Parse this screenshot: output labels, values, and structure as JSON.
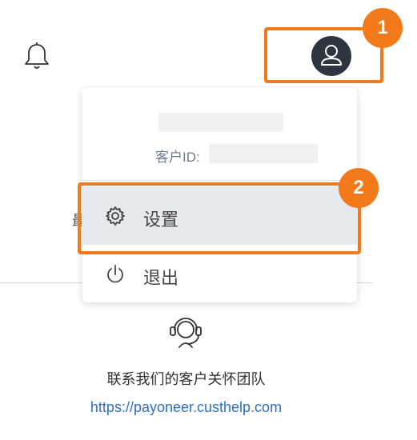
{
  "header": {
    "bell_icon": "bell-icon",
    "avatar_icon": "user-icon"
  },
  "badges": {
    "step1": "1",
    "step2": "2"
  },
  "menu": {
    "customer_id_label": "客户ID:",
    "items": [
      {
        "label": "设置",
        "icon": "gear-icon"
      },
      {
        "label": "退出",
        "icon": "power-icon"
      }
    ]
  },
  "support": {
    "text": "联系我们的客户关怀团队",
    "link": "https://payoneer.custhelp.com",
    "icon": "headset-icon"
  },
  "colors": {
    "highlight": "#f27a1a",
    "avatar_bg": "#2f3540",
    "selected_bg": "#e6e9ee",
    "link": "#2f6fc4"
  }
}
